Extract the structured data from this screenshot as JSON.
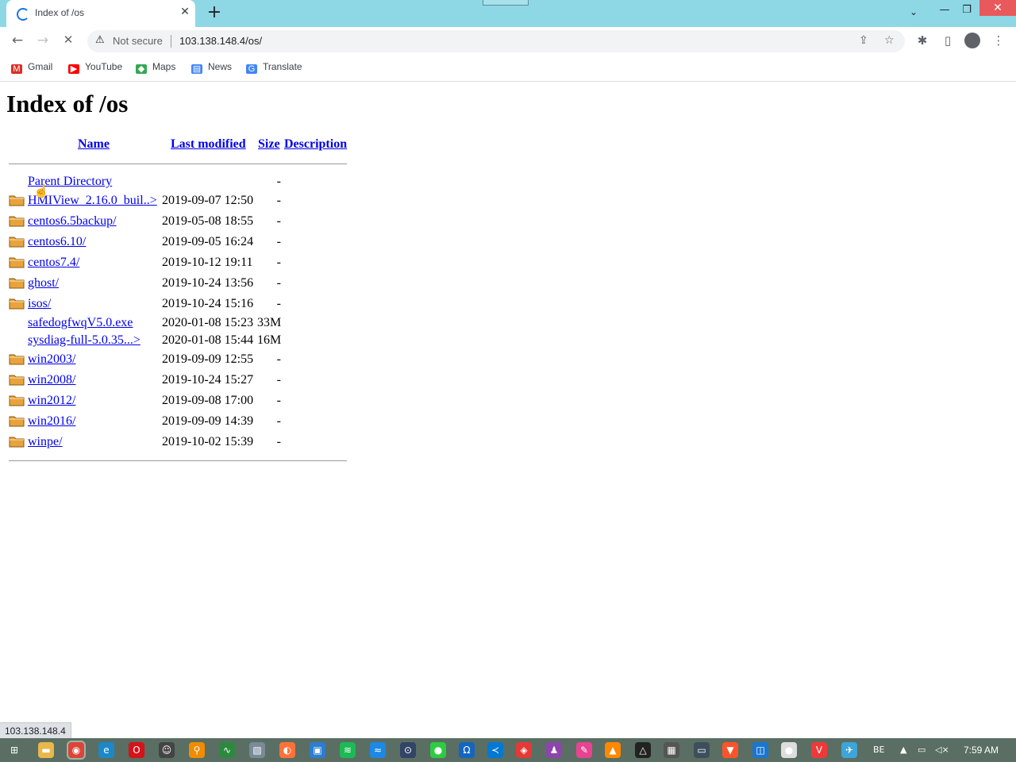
{
  "browser": {
    "tab": {
      "title": "Index of /os",
      "close": "✕"
    },
    "new_tab": "+",
    "window_controls": {
      "tab_menu": "⌄",
      "minimize": "—",
      "restore": "❐",
      "close": "✕"
    },
    "nav": {
      "back": "←",
      "forward": "→",
      "reload": "✕"
    },
    "omnibox": {
      "security_icon": "⚠",
      "security_label": "Not secure",
      "url": "103.138.148.4/os/"
    },
    "toolbar_icons": {
      "share": "⇪",
      "star": "☆",
      "extensions": "✱",
      "side_panel": "▯",
      "menu": "⋮"
    },
    "bookmarks": [
      {
        "label": "Gmail",
        "icon": "gmail-icon",
        "color": "#d93025",
        "glyph": "M"
      },
      {
        "label": "YouTube",
        "icon": "youtube-icon",
        "color": "#ff0000",
        "glyph": "▶"
      },
      {
        "label": "Maps",
        "icon": "maps-icon",
        "color": "#34a853",
        "glyph": "◆"
      },
      {
        "label": "News",
        "icon": "news-icon",
        "color": "#4285f4",
        "glyph": "▤"
      },
      {
        "label": "Translate",
        "icon": "translate-icon",
        "color": "#4285f4",
        "glyph": "G"
      }
    ]
  },
  "page": {
    "title": "Index of /os",
    "headers": {
      "name": "Name",
      "modified": "Last modified",
      "size": "Size",
      "description": "Description"
    },
    "rows": [
      {
        "name": "Parent Directory",
        "modified": "",
        "size": "-",
        "folder": false
      },
      {
        "name": "HMIView_2.16.0_buil..>",
        "modified": "2019-09-07 12:50",
        "size": "-",
        "folder": true
      },
      {
        "name": "centos6.5backup/",
        "modified": "2019-05-08 18:55",
        "size": "-",
        "folder": true
      },
      {
        "name": "centos6.10/",
        "modified": "2019-09-05 16:24",
        "size": "-",
        "folder": true
      },
      {
        "name": "centos7.4/",
        "modified": "2019-10-12 19:11",
        "size": "-",
        "folder": true
      },
      {
        "name": "ghost/",
        "modified": "2019-10-24 13:56",
        "size": "-",
        "folder": true
      },
      {
        "name": "isos/",
        "modified": "2019-10-24 15:16",
        "size": "-",
        "folder": true
      },
      {
        "name": "safedogfwqV5.0.exe",
        "modified": "2020-01-08 15:23",
        "size": "33M",
        "folder": false
      },
      {
        "name": "sysdiag-full-5.0.35...>",
        "modified": "2020-01-08 15:44",
        "size": "16M",
        "folder": false
      },
      {
        "name": "win2003/",
        "modified": "2019-09-09 12:55",
        "size": "-",
        "folder": true
      },
      {
        "name": "win2008/",
        "modified": "2019-10-24 15:27",
        "size": "-",
        "folder": true
      },
      {
        "name": "win2012/",
        "modified": "2019-09-08 17:00",
        "size": "-",
        "folder": true
      },
      {
        "name": "win2016/",
        "modified": "2019-09-09 14:39",
        "size": "-",
        "folder": true
      },
      {
        "name": "winpe/",
        "modified": "2019-10-02 15:39",
        "size": "-",
        "folder": true
      }
    ]
  },
  "status_bar": {
    "text": "103.138.148.4"
  },
  "taskbar": {
    "clock": "7:59 AM",
    "tray_language": "BE",
    "apps": [
      {
        "name": "start-icon",
        "color": "#5a6e63",
        "glyph": "⊞"
      },
      {
        "name": "file-explorer-icon",
        "color": "#e8b84a",
        "glyph": "▬"
      },
      {
        "name": "chrome-icon",
        "color": "#db4437",
        "glyph": "◉"
      },
      {
        "name": "edge-icon",
        "color": "#1b88c9",
        "glyph": "e"
      },
      {
        "name": "opera-icon",
        "color": "#d6121a",
        "glyph": "O"
      },
      {
        "name": "raccoon-icon",
        "color": "#444444",
        "glyph": "☺"
      },
      {
        "name": "search-tool-icon",
        "color": "#f08c00",
        "glyph": "⚲"
      },
      {
        "name": "wire-icon",
        "color": "#2b8a3e",
        "glyph": "∿"
      },
      {
        "name": "photos-icon",
        "color": "#7a8a99",
        "glyph": "▧"
      },
      {
        "name": "firefox-icon",
        "color": "#ff7139",
        "glyph": "◐"
      },
      {
        "name": "store-icon",
        "color": "#2d7dd2",
        "glyph": "▣"
      },
      {
        "name": "spotify-icon",
        "color": "#1db954",
        "glyph": "≋"
      },
      {
        "name": "swift-icon",
        "color": "#1e88e5",
        "glyph": "≈"
      },
      {
        "name": "lock-icon",
        "color": "#334466",
        "glyph": "⊙"
      },
      {
        "name": "green-dot-icon",
        "color": "#2ecc40",
        "glyph": "●"
      },
      {
        "name": "headset-icon",
        "color": "#1565c0",
        "glyph": "Ω"
      },
      {
        "name": "vscode-icon",
        "color": "#0078d4",
        "glyph": "≺"
      },
      {
        "name": "shield-app-icon",
        "color": "#e53935",
        "glyph": "◈"
      },
      {
        "name": "ghost-app-icon",
        "color": "#8e44ad",
        "glyph": "♟"
      },
      {
        "name": "paint-icon",
        "color": "#e84393",
        "glyph": "✎"
      },
      {
        "name": "vlc-icon",
        "color": "#ff8800",
        "glyph": "▲"
      },
      {
        "name": "warning-app-icon",
        "color": "#222222",
        "glyph": "△"
      },
      {
        "name": "clapper-icon",
        "color": "#555555",
        "glyph": "▦"
      },
      {
        "name": "monitor-icon",
        "color": "#3d4f5c",
        "glyph": "▭"
      },
      {
        "name": "brave-icon",
        "color": "#fb542b",
        "glyph": "▼"
      },
      {
        "name": "window-app-icon",
        "color": "#1976d2",
        "glyph": "◫"
      },
      {
        "name": "ball-icon",
        "color": "#dddddd",
        "glyph": "●"
      },
      {
        "name": "vivaldi-icon",
        "color": "#ef3939",
        "glyph": "V"
      },
      {
        "name": "wrench-icon",
        "color": "#3da5d9",
        "glyph": "✈"
      }
    ]
  }
}
